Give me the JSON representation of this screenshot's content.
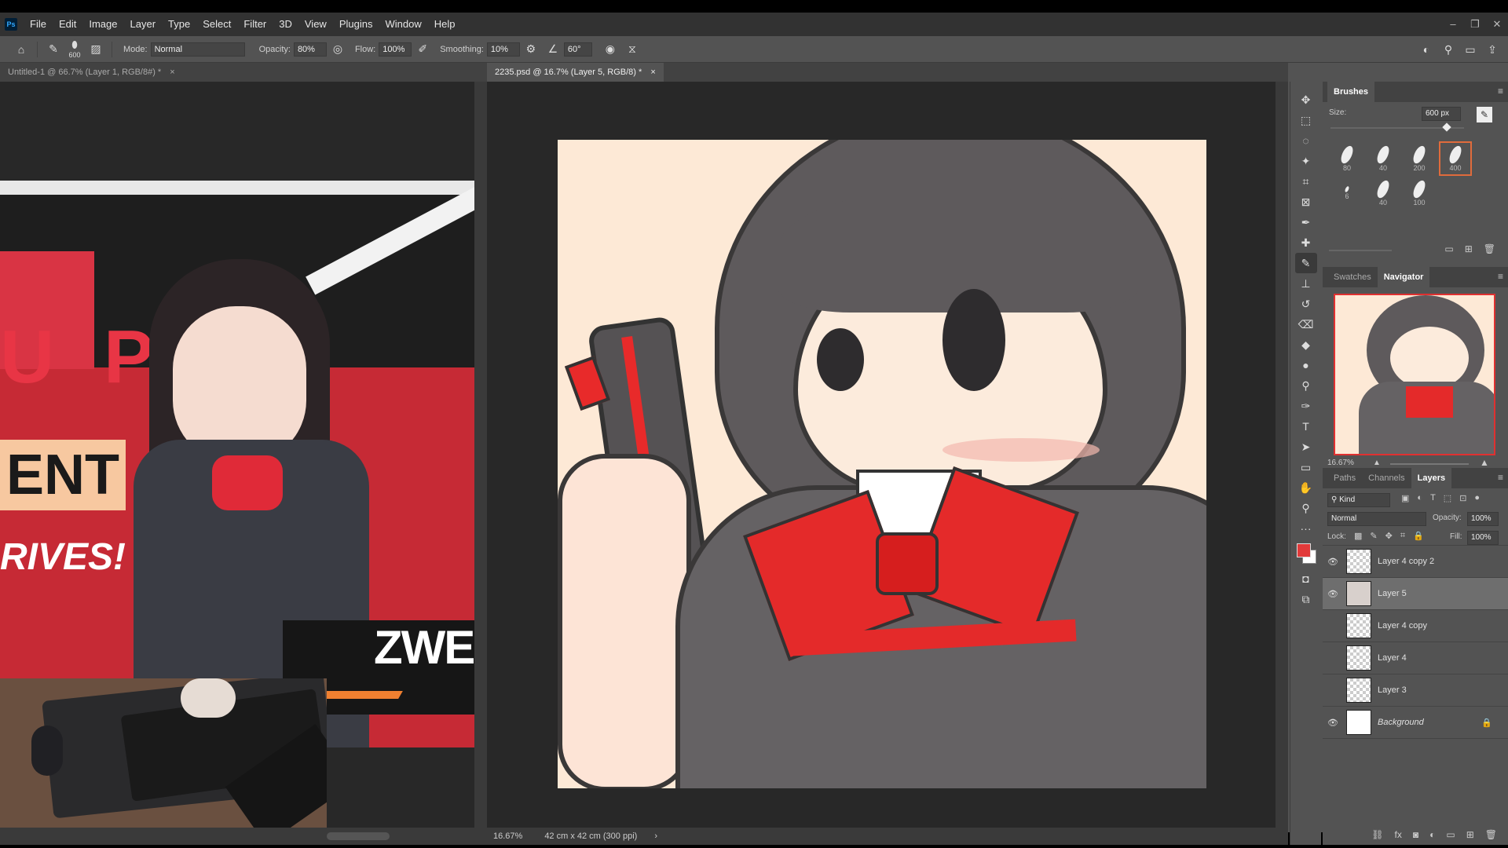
{
  "menubar": {
    "logo": "Ps",
    "items": [
      "File",
      "Edit",
      "Image",
      "Layer",
      "Type",
      "Select",
      "Filter",
      "3D",
      "View",
      "Plugins",
      "Window",
      "Help"
    ],
    "window_controls": [
      "–",
      "❐",
      "✕"
    ]
  },
  "options": {
    "brush_size": "600",
    "mode_label": "Mode:",
    "mode_value": "Normal",
    "opacity_label": "Opacity:",
    "opacity_value": "80%",
    "flow_label": "Flow:",
    "flow_value": "100%",
    "smoothing_label": "Smoothing:",
    "smoothing_value": "10%",
    "angle_value": "60°"
  },
  "tabs": {
    "left": "Untitled-1 @ 66.7% (Layer 1, RGB/8#) *",
    "right": "2235.psd @ 16.7% (Layer 5, RGB/8) *",
    "close": "×"
  },
  "left_canvas": {
    "banner_letters": "U P",
    "banner_word": "ENT",
    "banner_tagline": "RIVES!",
    "character_name": "ZWEI"
  },
  "status": {
    "zoom": "16.67%",
    "doc_size": "42 cm x 42 cm (300 ppi)",
    "arrow": "›"
  },
  "brushes_panel": {
    "title": "Brushes",
    "size_label": "Size:",
    "size_value": "600 px",
    "presets": [
      "80",
      "40",
      "200",
      "400",
      "6",
      "40",
      "100"
    ]
  },
  "navigator": {
    "tabs": [
      "Swatches",
      "Navigator"
    ],
    "zoom": "16.67%"
  },
  "layers_panel": {
    "tabs": [
      "Paths",
      "Channels",
      "Layers"
    ],
    "filter_label": "Kind",
    "blend_mode": "Normal",
    "opacity_label": "Opacity:",
    "opacity_value": "100%",
    "lock_label": "Lock:",
    "fill_label": "Fill:",
    "fill_value": "100%",
    "layers": [
      {
        "name": "Layer 4 copy 2",
        "visible": true
      },
      {
        "name": "Layer 5",
        "visible": true
      },
      {
        "name": "Layer 4 copy",
        "visible": false
      },
      {
        "name": "Layer 4",
        "visible": false
      },
      {
        "name": "Layer 3",
        "visible": false
      },
      {
        "name": "Background",
        "visible": true
      }
    ]
  },
  "colors": {
    "foreground": "#e23a3a",
    "background": "#ffffff"
  }
}
